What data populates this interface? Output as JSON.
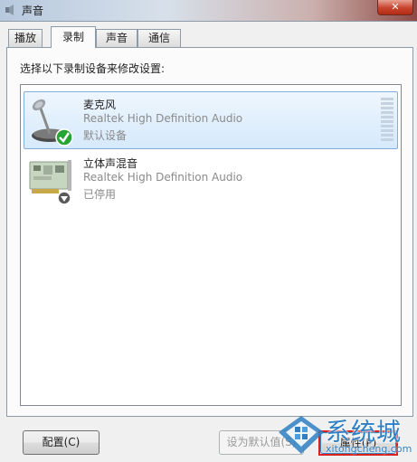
{
  "window": {
    "title": "声音",
    "close_label": "✕",
    "icon": "speaker-icon"
  },
  "tabs": [
    {
      "label": "播放",
      "active": false
    },
    {
      "label": "录制",
      "active": true
    },
    {
      "label": "声音",
      "active": false
    },
    {
      "label": "通信",
      "active": false
    }
  ],
  "panel": {
    "instruction": "选择以下录制设备来修改设置:"
  },
  "devices": [
    {
      "name": "麦克风",
      "driver": "Realtek High Definition Audio",
      "status": "默认设备",
      "icon": "microphone-icon",
      "badge": "checkmark-icon",
      "selected": true
    },
    {
      "name": "立体声混音",
      "driver": "Realtek High Definition Audio",
      "status": "已停用",
      "icon": "sound-card-icon",
      "badge": "disabled-arrow-icon",
      "selected": false
    }
  ],
  "buttons": {
    "configure": "配置(C)",
    "set_default": "设为默认值(S)",
    "properties": "属性(P)"
  },
  "watermark": {
    "text_cn": "系统城",
    "text_en": "xitongcheng.com"
  },
  "colors": {
    "selection": "#d6e9fb",
    "accent": "#2f7fc2",
    "check_green": "#27a534",
    "highlight_red": "#d9231c"
  }
}
